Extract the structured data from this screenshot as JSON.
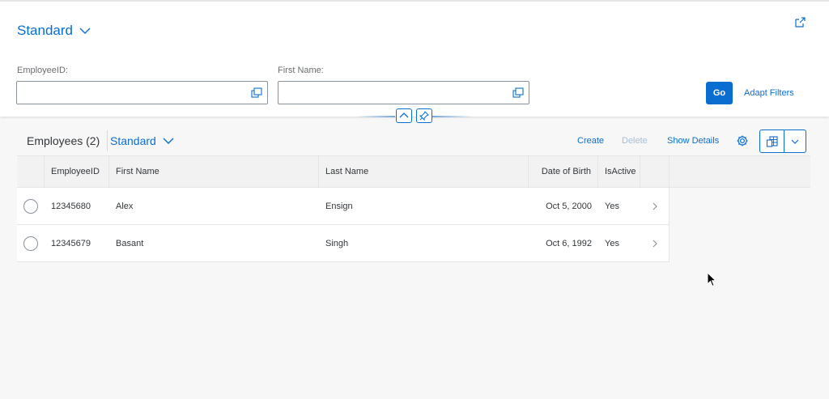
{
  "header": {
    "variant_label": "Standard",
    "filters": [
      {
        "label": "EmployeeID:",
        "value": "",
        "placeholder": ""
      },
      {
        "label": "First Name:",
        "value": "",
        "placeholder": ""
      }
    ],
    "go_label": "Go",
    "adapt_filters_label": "Adapt Filters"
  },
  "table": {
    "title": "Employees (2)",
    "variant_label": "Standard",
    "actions": {
      "create": "Create",
      "delete": "Delete",
      "show_details": "Show Details"
    },
    "columns": [
      "EmployeeID",
      "First Name",
      "Last Name",
      "Date of Birth",
      "IsActive"
    ],
    "rows": [
      {
        "employee_id": "12345680",
        "first_name": "Alex",
        "last_name": "Ensign",
        "dob": "Oct 5, 2000",
        "is_active": "Yes"
      },
      {
        "employee_id": "12345679",
        "first_name": "Basant",
        "last_name": "Singh",
        "dob": "Oct 6, 1992",
        "is_active": "Yes"
      }
    ]
  },
  "colors": {
    "accent": "#0a6ed1",
    "header_bg": "#ffffff",
    "page_bg": "#f7f7f7",
    "table_header_bg": "#f2f2f2",
    "disabled_link": "#a5bfd9"
  },
  "icons": {
    "variant_chevron": "chevron-down-icon",
    "share": "share-icon",
    "value_help": "value-help-icon",
    "collapse": "chevron-up-icon",
    "pin": "pin-icon",
    "settings": "gear-icon",
    "export": "spreadsheet-export-icon",
    "export_menu": "chevron-down-icon",
    "row_nav": "chevron-right-icon"
  }
}
